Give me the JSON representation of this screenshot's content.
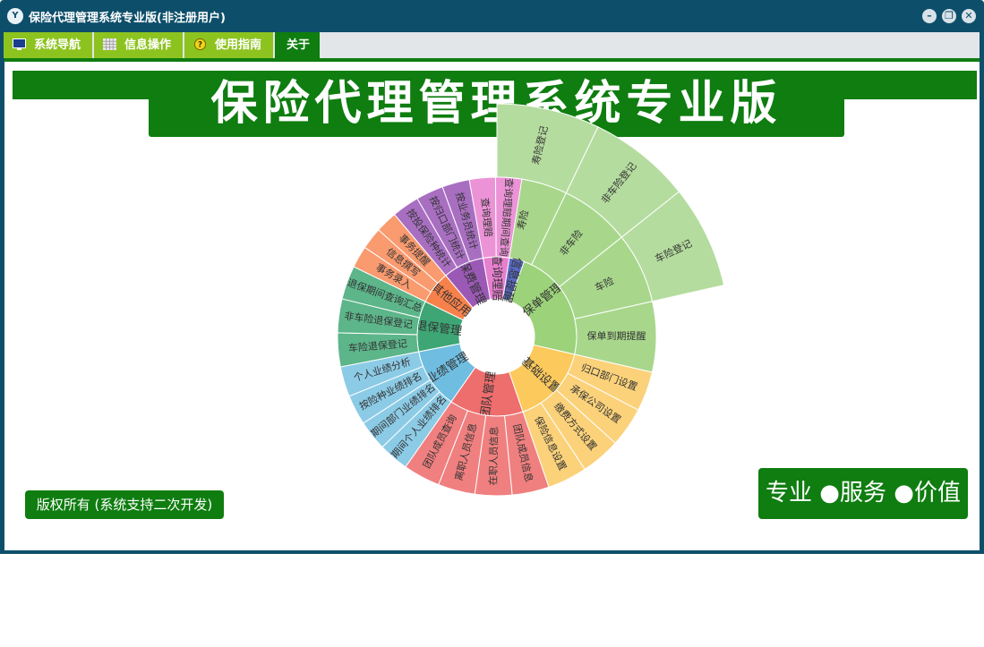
{
  "window": {
    "title": "保险代理管理系统专业版(非注册用户)",
    "app_icon": "Y"
  },
  "menu": [
    {
      "label": "系统导航",
      "icon": "monitor-icon"
    },
    {
      "label": "信息操作",
      "icon": "grid-icon"
    },
    {
      "label": "使用指南",
      "icon": "help-icon"
    },
    {
      "label": "关于",
      "icon": ""
    }
  ],
  "banner": {
    "title": "保险代理管理系统专业版",
    "copyright": "版权所有 (系统支持二次开发)",
    "slogan": "专业 ●服务 ●价值"
  },
  "colors": {
    "accent_green": "#0f7d10",
    "menu_green": "#8dc31f",
    "window_frame": "#0d4f6a"
  },
  "sunburst": {
    "inner": [
      {
        "label": "保单管理",
        "color": "#9bd27a",
        "children": [
          {
            "label": "寿险",
            "color": "#a8d78c",
            "children": [
              {
                "label": "寿险登记"
              }
            ]
          },
          {
            "label": "非车险",
            "color": "#a8d78c",
            "children": [
              {
                "label": "非车险登记"
              }
            ]
          },
          {
            "label": "车险",
            "color": "#a8d78c",
            "children": [
              {
                "label": "车险登记"
              }
            ]
          },
          {
            "label": "保单到期提醒",
            "color": "#a8d78c",
            "children": []
          }
        ]
      },
      {
        "label": "基础设置",
        "color": "#fbc95c",
        "children": [
          {
            "label": "归口部门设置",
            "color": "#fbd27a",
            "children": []
          },
          {
            "label": "承保公司设置",
            "color": "#fbd27a",
            "children": []
          },
          {
            "label": "缴费方式设置",
            "color": "#fbd27a",
            "children": []
          },
          {
            "label": "保险信息设置",
            "color": "#fbd27a",
            "children": []
          }
        ]
      },
      {
        "label": "团队管理",
        "color": "#ee6d6d",
        "children": [
          {
            "label": "团队成员信息",
            "color": "#f07f7f",
            "children": []
          },
          {
            "label": "在职人员信息",
            "color": "#f07f7f",
            "children": []
          },
          {
            "label": "离职人员信息",
            "color": "#f07f7f",
            "children": []
          },
          {
            "label": "团队成员查询",
            "color": "#f07f7f",
            "children": []
          }
        ]
      },
      {
        "label": "业绩管理",
        "color": "#6fbde0",
        "children": [
          {
            "label": "期间个人业绩排名",
            "color": "#8ccbe6",
            "children": []
          },
          {
            "label": "期间部门业绩排名",
            "color": "#8ccbe6",
            "children": []
          },
          {
            "label": "按险种业绩排名",
            "color": "#8ccbe6",
            "children": []
          },
          {
            "label": "个人业绩分析",
            "color": "#8ccbe6",
            "children": []
          }
        ]
      },
      {
        "label": "退保管理",
        "color": "#3ea675",
        "children": [
          {
            "label": "车险退保登记",
            "color": "#5db58a",
            "children": []
          },
          {
            "label": "非车险退保登记",
            "color": "#5db58a",
            "children": []
          },
          {
            "label": "退保期间查询汇总",
            "color": "#5db58a",
            "children": []
          }
        ]
      },
      {
        "label": "其他应用",
        "color": "#f7814a",
        "children": [
          {
            "label": "事务录入",
            "color": "#f99a6f",
            "children": []
          },
          {
            "label": "信息撰写",
            "color": "#f99a6f",
            "children": []
          },
          {
            "label": "事务提醒",
            "color": "#f99a6f",
            "children": []
          }
        ]
      },
      {
        "label": "保费管理",
        "color": "#9b59b6",
        "children": [
          {
            "label": "按投保险种统计",
            "color": "#a86fc1",
            "children": []
          },
          {
            "label": "按归口部门统计",
            "color": "#a86fc1",
            "children": []
          },
          {
            "label": "按业务员统计",
            "color": "#a86fc1",
            "children": []
          }
        ]
      },
      {
        "label": "查询理赔",
        "color": "#e77fcf",
        "children": [
          {
            "label": "查询理赔",
            "color": "#ec93d7",
            "children": []
          },
          {
            "label": "查询理赔期间查询",
            "color": "#ec93d7",
            "children": []
          }
        ]
      },
      {
        "label": "信息提醒",
        "color": "#5869c2",
        "children": []
      }
    ]
  }
}
